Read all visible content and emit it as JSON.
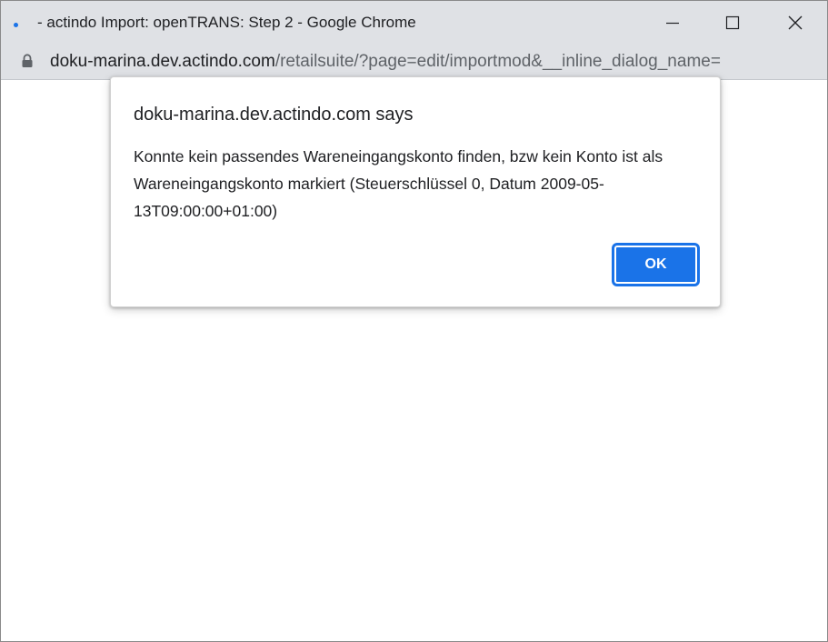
{
  "window": {
    "title": " - actindo Import: openTRANS: Step 2 - Google Chrome",
    "favicon": "loading-dot-icon",
    "controls": {
      "minimize": "minimize-icon",
      "maximize": "maximize-icon",
      "close": "close-icon"
    }
  },
  "addressbar": {
    "host": "doku-marina.dev.actindo.com",
    "path": "/retailsuite/?page=edit/importmod&__inline_dialog_name=",
    "lock": "lock-icon"
  },
  "dialog": {
    "title": "doku-marina.dev.actindo.com says",
    "message": "Konnte kein passendes Wareneingangskonto finden, bzw kein Konto ist als Wareneingangskonto markiert (Steuerschlüssel 0, Datum 2009-05-13T09:00:00+01:00)",
    "ok_label": "OK"
  },
  "colors": {
    "titlebar": "#dfe1e5",
    "accent": "#1a73e8",
    "text": "#202124",
    "url_path": "#5f6368"
  }
}
